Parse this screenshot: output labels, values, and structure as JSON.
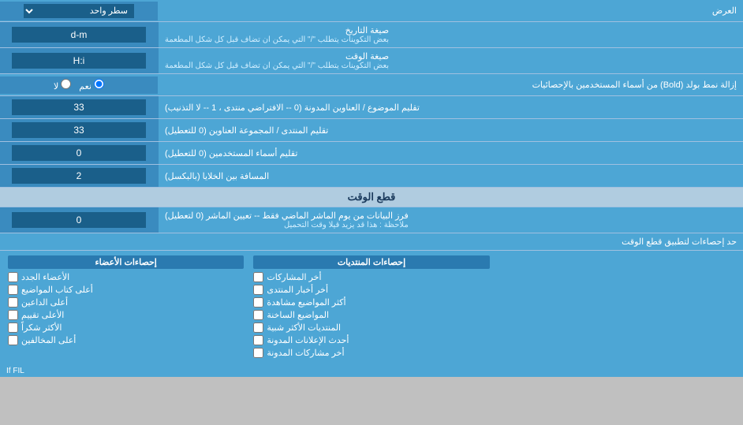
{
  "header": {
    "title": "العرض"
  },
  "rows": [
    {
      "id": "row-one-line",
      "label": "",
      "input_type": "select",
      "select_value": "سطر واحد"
    },
    {
      "id": "row-date-format",
      "label": "صيغة التاريخ",
      "sublabel": "بعض التكوينات يتطلب \"/\" التي يمكن ان تضاف قبل كل شكل المطعمة",
      "input_type": "text",
      "value": "d-m"
    },
    {
      "id": "row-time-format",
      "label": "صيغة الوقت",
      "sublabel": "بعض التكوينات يتطلب \"/\" التي يمكن ان تضاف قبل كل شكل المطعمة",
      "input_type": "text",
      "value": "H:i"
    },
    {
      "id": "row-bold",
      "label": "إزالة نمط بولد (Bold) من أسماء المستخدمين بالإحصائيات",
      "input_type": "radio",
      "options": [
        "نعم",
        "لا"
      ],
      "selected": "نعم"
    },
    {
      "id": "row-titles",
      "label": "تقليم الموضوع / العناوين المدونة (0 -- الافتراضي منتدى ، 1 -- لا التذنيب)",
      "input_type": "text",
      "value": "33"
    },
    {
      "id": "row-forum",
      "label": "تقليم المنتدى / المجموعة العناوين (0 للتعطيل)",
      "input_type": "text",
      "value": "33"
    },
    {
      "id": "row-usernames",
      "label": "تقليم أسماء المستخدمين (0 للتعطيل)",
      "input_type": "text",
      "value": "0"
    },
    {
      "id": "row-space",
      "label": "المسافة بين الخلايا (بالبكسل)",
      "input_type": "text",
      "value": "2"
    }
  ],
  "section_cutoff": {
    "title": "قطع الوقت"
  },
  "cutoff_row": {
    "label": "فرز البيانات من يوم الماشر الماضي فقط -- تعيين الماشر (0 لتعطيل)",
    "note": "ملاحظة : هذا قد يزيد قيلا وقت التحميل",
    "value": "0"
  },
  "stats_limit": {
    "label": "حد إحصاءات لتطبيق قطع الوقت"
  },
  "checkboxes": {
    "col1_header": "",
    "col2_header": "إحصاءات المنتديات",
    "col3_header": "إحصاءات الأعضاء",
    "col1_items": [],
    "col2_items": [
      "أخر المشاركات",
      "أخر أخبار المنتدى",
      "أكثر المواضيع مشاهدة",
      "المواضيع الساخنة",
      "المنتديات الأكثر شبية",
      "أحدث الإعلانات المدونة",
      "أخر مشاركات المدونة"
    ],
    "col3_items": [
      "الأعضاء الجدد",
      "أعلى كتاب المواضيع",
      "أعلى الداعين",
      "الأعلى تقييم",
      "الأكثر شكراً",
      "أعلى المخالفين"
    ]
  },
  "bottom_note": "If FIL"
}
